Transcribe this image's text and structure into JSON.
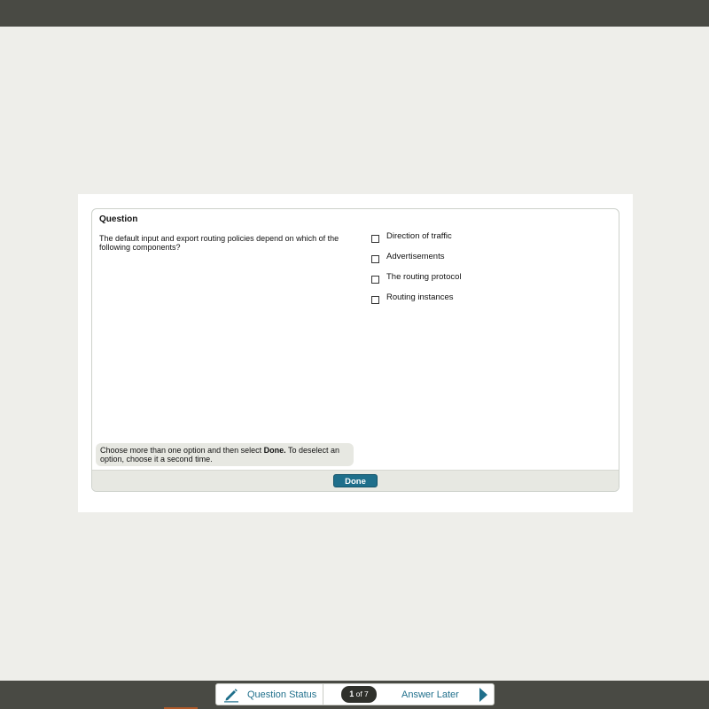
{
  "question": {
    "title": "Question",
    "text": "The default input and export routing policies depend on which of the following components?",
    "options": [
      {
        "label": "Direction of traffic",
        "checked": false
      },
      {
        "label": "Advertisements",
        "checked": false
      },
      {
        "label": "The routing protocol",
        "checked": false
      },
      {
        "label": "Routing instances",
        "checked": false
      }
    ],
    "instruction_pre": "Choose more than one option and then select ",
    "instruction_bold": "Done.",
    "instruction_post": " To deselect an option, choose it a second time.",
    "done_label": "Done"
  },
  "nav": {
    "status_label": "Question Status",
    "current": "1",
    "of_total": "of 7",
    "answer_later_label": "Answer Later",
    "icons": {
      "status": "pencil-icon",
      "next": "play-arrow-icon"
    }
  },
  "colors": {
    "bar": "#494a44",
    "accent": "#1f6f8b",
    "background": "#eeeeea"
  }
}
